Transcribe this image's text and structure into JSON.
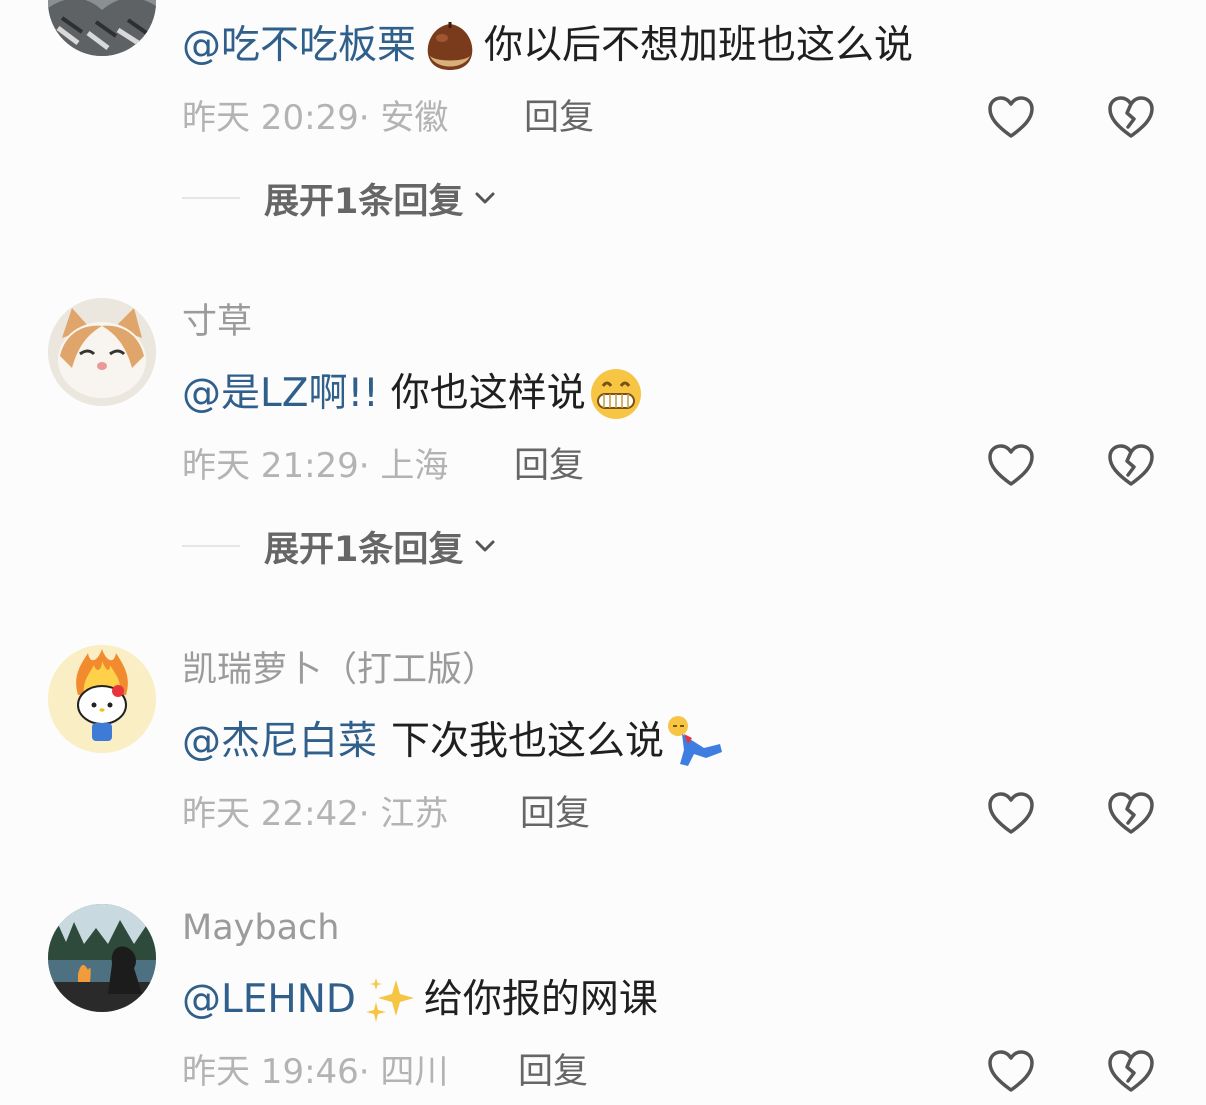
{
  "comments": [
    {
      "username": "",
      "mention": "@吃不吃板栗",
      "emoji": "chestnut",
      "text": "你以后不想加班也这么说",
      "meta": "昨天 20:29· 安徽",
      "reply_label": "回复",
      "expand_label": "展开1条回复"
    },
    {
      "username": "寸草",
      "mention": "@是LZ啊!!",
      "text": "你也这样说",
      "emoji": "grin",
      "meta": "昨天 21:29· 上海",
      "reply_label": "回复",
      "expand_label": "展开1条回复"
    },
    {
      "username": "凯瑞萝卜（打工版）",
      "mention": "@杰尼白菜",
      "text": "下次我也这么说",
      "emoji": "lying-down",
      "meta": "昨天 22:42· 江苏",
      "reply_label": "回复"
    },
    {
      "username": "Maybach",
      "mention": "@LEHND",
      "emoji": "sparkles",
      "text": "给你报的网课",
      "meta": "昨天 19:46· 四川",
      "reply_label": "回复"
    }
  ],
  "colors": {
    "mention": "#2f5f8a",
    "text": "#1f1f1f",
    "meta": "#b3b3b3",
    "username": "#9b9b9b",
    "reply": "#666666",
    "icon": "#555555"
  }
}
